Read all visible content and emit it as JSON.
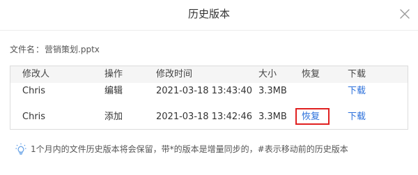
{
  "dialog": {
    "title": "历史版本"
  },
  "file": {
    "label": "文件名",
    "separator": "：",
    "name": "营销策划.pptx"
  },
  "table": {
    "headers": {
      "user": "修改人",
      "op": "操作",
      "time": "修改时间",
      "size": "大小",
      "restore": "恢复",
      "download": "下载"
    },
    "rows": [
      {
        "user": "Chris",
        "op": "编辑",
        "time": "2021-03-18 13:43:40",
        "size": "3.3MB",
        "restore": "",
        "download": "下载"
      },
      {
        "user": "Chris",
        "op": "添加",
        "time": "2021-03-18 13:42:46",
        "size": "3.3MB",
        "restore": "恢复",
        "download": "下载"
      }
    ]
  },
  "tip": {
    "text": "1个月内的文件历史版本将会保留，带*的版本是增量同步的，#表示移动前的历史版本"
  },
  "colors": {
    "link": "#2a6fdb",
    "highlight_border": "#e02020",
    "tip_icon": "#4a90e2"
  },
  "icons": {
    "close": "close-icon",
    "tip": "lightbulb-icon"
  }
}
